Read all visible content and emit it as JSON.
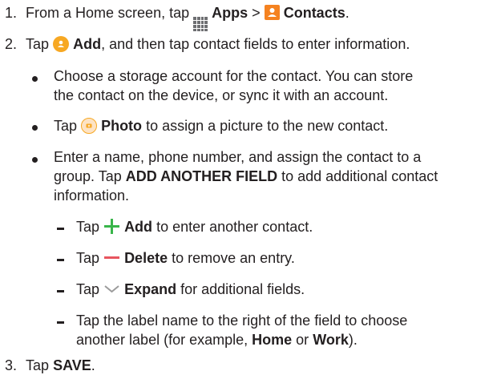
{
  "steps": {
    "step1": {
      "number": "1.",
      "text_before": "From a Home screen, tap",
      "apps_label": "Apps",
      "separator": ">",
      "contacts_label": "Contacts",
      "text_after": "."
    },
    "step2": {
      "number": "2.",
      "text_before": "Tap",
      "add_label": "Add",
      "text_after": ", and then tap contact fields to enter information."
    },
    "bullets": [
      {
        "line1": "Choose a storage account for the contact. You can store",
        "line2": "the contact on the device, or sync it with an account."
      },
      {
        "text_before": "Tap",
        "photo_label": "Photo",
        "text_after": "to assign a picture to the new contact."
      },
      {
        "line1": "Enter a name, phone number, and assign the contact to a",
        "line2_before": "group. Tap",
        "line2_bold": "ADD ANOTHER FIELD",
        "line2_after": "to add additional contact",
        "line3": "information."
      }
    ],
    "subitems": [
      {
        "text_before": "Tap",
        "bold": "Add",
        "text_after": "to enter another contact.",
        "icon": "plus-icon",
        "icon_color": "#39b54a"
      },
      {
        "text_before": "Tap",
        "bold": "Delete",
        "text_after": "to remove an entry.",
        "icon": "minus-icon",
        "icon_color": "#e8555f"
      },
      {
        "text_before": "Tap",
        "bold": "Expand",
        "text_after": "for additional fields.",
        "icon": "chevron-down-icon",
        "icon_color": "#9b9b9b"
      },
      {
        "line1": "Tap the label name to the right of the field to choose",
        "line2_before": "another label (for example,",
        "bold1": "Home",
        "or": "or",
        "bold2": "Work",
        "line2_after": ")."
      }
    ],
    "step3": {
      "number": "3.",
      "text_before": "Tap",
      "save_label": "SAVE",
      "text_after": "."
    }
  },
  "icons": {
    "apps": "apps-grid-icon",
    "contacts": "contacts-icon",
    "add": "add-contact-icon",
    "photo": "photo-icon"
  },
  "colors": {
    "text": "#231f20",
    "orange": "#f7a823",
    "contacts_orange": "#f58220",
    "green": "#39b54a",
    "red": "#e8555f",
    "gray": "#9b9b9b"
  }
}
